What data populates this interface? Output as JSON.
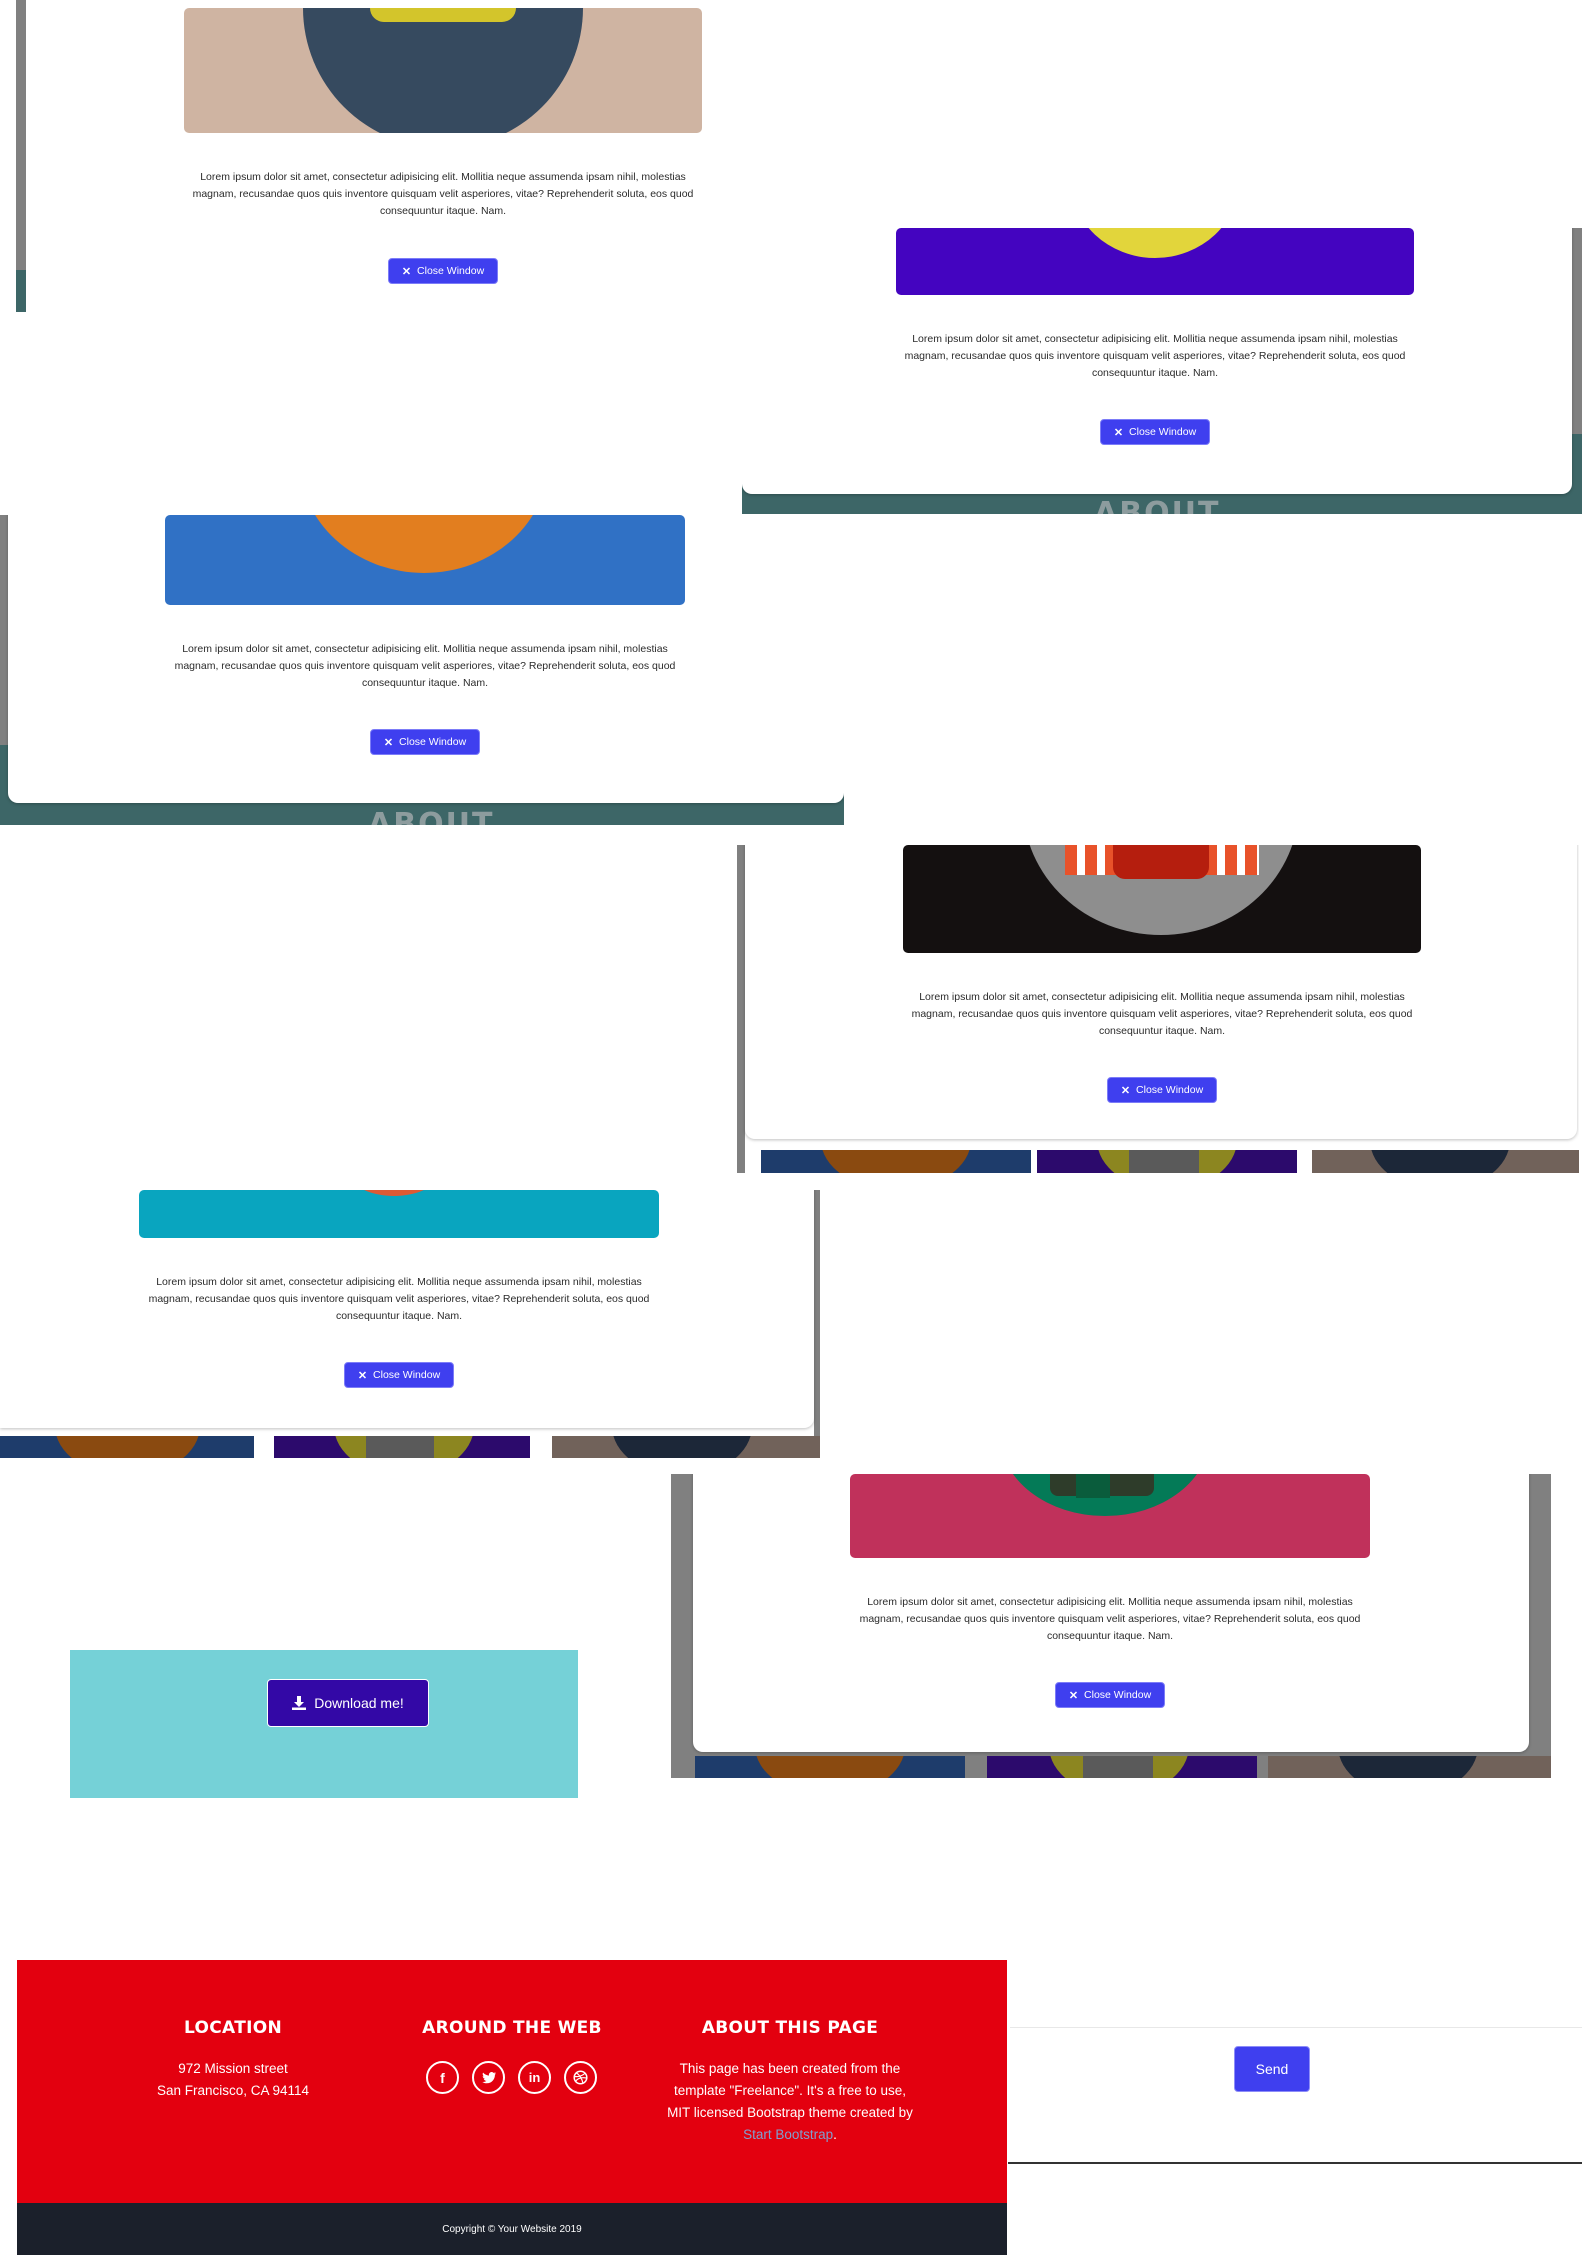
{
  "modal": {
    "body_text": "Lorem ipsum dolor sit amet, consectetur adipisicing elit. Mollitia neque assumenda ipsam nihil, molestias magnam, recusandae quos quis inventore quisquam velit asperiores, vitae? Reprehenderit soluta, eos quod consequuntur itaque. Nam.",
    "close_label": "Close Window",
    "close_icon": "close-icon"
  },
  "section": {
    "about_ghost": "ABOUT"
  },
  "download": {
    "label": "Download me!",
    "icon": "download-icon"
  },
  "contact": {
    "send_label": "Send"
  },
  "footer": {
    "location_heading": "LOCATION",
    "address_line1": "972 Mission street",
    "address_line2": "San Francisco, CA 94114",
    "web_heading": "AROUND THE WEB",
    "social": [
      "facebook-icon",
      "twitter-icon",
      "linkedin-icon",
      "dribbble-icon"
    ],
    "about_heading": "ABOUT THIS PAGE",
    "about_text_1": "This page has been created from the template \"Freelance\". It's a free to use, MIT licensed Bootstrap theme created by ",
    "about_link": "Start Bootstrap",
    "about_text_2": ".",
    "copyright": "Copyright © Your Website 2019"
  },
  "colors": {
    "brand_red": "#e3000f",
    "copyright_bar": "#1b202b",
    "button_blue": "#3f3fef",
    "teal_section": "#3d6667",
    "cyan_block": "#75d1d7",
    "download_button": "#3308a6"
  }
}
